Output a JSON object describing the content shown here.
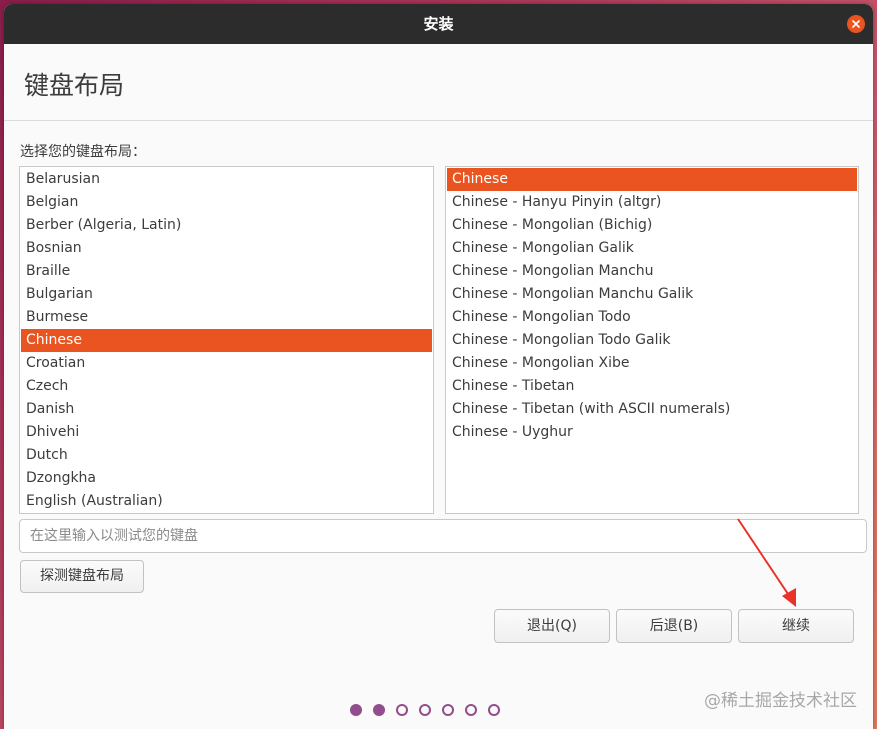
{
  "window": {
    "title": "安装"
  },
  "page": {
    "title": "键盘布局",
    "instruction": "选择您的键盘布局："
  },
  "layouts": {
    "items": [
      "Belarusian",
      "Belgian",
      "Berber (Algeria, Latin)",
      "Bosnian",
      "Braille",
      "Bulgarian",
      "Burmese",
      "Chinese",
      "Croatian",
      "Czech",
      "Danish",
      "Dhivehi",
      "Dutch",
      "Dzongkha",
      "English (Australian)"
    ],
    "selected": "Chinese"
  },
  "variants": {
    "items": [
      "Chinese",
      "Chinese - Hanyu Pinyin (altgr)",
      "Chinese - Mongolian (Bichig)",
      "Chinese - Mongolian Galik",
      "Chinese - Mongolian Manchu",
      "Chinese - Mongolian Manchu Galik",
      "Chinese - Mongolian Todo",
      "Chinese - Mongolian Todo Galik",
      "Chinese - Mongolian Xibe",
      "Chinese - Tibetan",
      "Chinese - Tibetan (with ASCII numerals)",
      "Chinese - Uyghur"
    ],
    "selected": "Chinese"
  },
  "test_input": {
    "placeholder": "在这里输入以测试您的键盘",
    "value": ""
  },
  "buttons": {
    "detect": "探测键盘布局",
    "quit": "退出(Q)",
    "back": "后退(B)",
    "continue": "继续"
  },
  "progress": {
    "total_steps": 7,
    "completed_steps": 2
  },
  "watermark": "@稀土掘金技术社区",
  "colors": {
    "accent": "#e95420",
    "titlebar": "#2c2c2c",
    "progress_dot": "#924d8b",
    "annotation_arrow": "#e8322b"
  }
}
